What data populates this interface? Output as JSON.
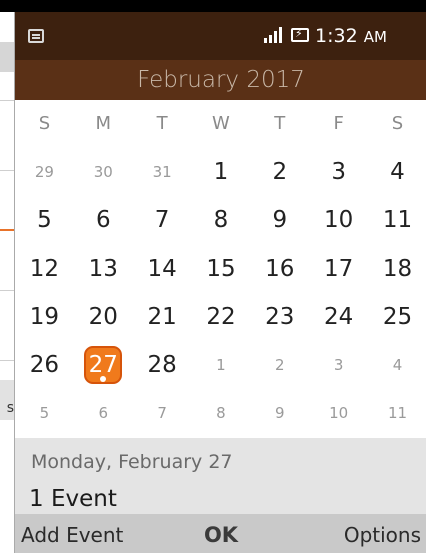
{
  "background": {
    "partial_letter": "s"
  },
  "status_bar": {
    "time": "1:32",
    "ampm": "AM",
    "signal_icon": "signal-icon",
    "battery_icon": "battery-charging-icon",
    "app_icon": "calendar-app-icon",
    "color": "#3d210f"
  },
  "calendar": {
    "month_title": "February 2017",
    "header_color": "#5a3016",
    "today_color": "#f07a1c",
    "weekdays": [
      "S",
      "M",
      "T",
      "W",
      "T",
      "F",
      "S"
    ],
    "weeks": [
      [
        "29",
        "30",
        "31",
        "1",
        "2",
        "3",
        "4"
      ],
      [
        "5",
        "6",
        "7",
        "8",
        "9",
        "10",
        "11"
      ],
      [
        "12",
        "13",
        "14",
        "15",
        "16",
        "17",
        "18"
      ],
      [
        "19",
        "20",
        "21",
        "22",
        "23",
        "24",
        "25"
      ],
      [
        "26",
        "27",
        "28",
        "1",
        "2",
        "3",
        "4"
      ],
      [
        "5",
        "6",
        "7",
        "8",
        "9",
        "10",
        "11"
      ]
    ],
    "selected_day": "27"
  },
  "event_panel": {
    "date_label": "Monday, February 27",
    "count_label": "1 Event"
  },
  "softkeys": {
    "left": "Add Event",
    "center": "OK",
    "right": "Options"
  }
}
